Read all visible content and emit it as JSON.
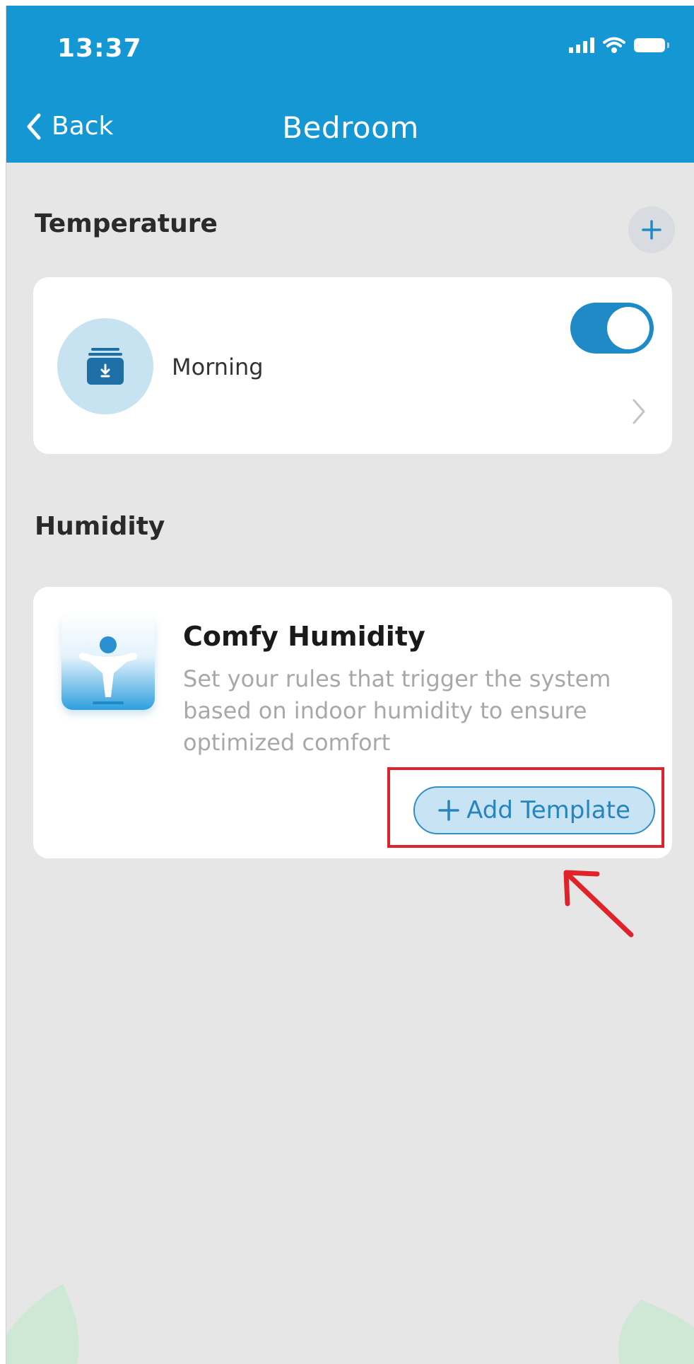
{
  "status_bar": {
    "time": "13:37"
  },
  "nav": {
    "back_label": "Back",
    "title": "Bedroom"
  },
  "temperature": {
    "heading": "Temperature",
    "schedule": {
      "name": "Morning",
      "enabled": true
    }
  },
  "humidity": {
    "heading": "Humidity",
    "template": {
      "title": "Comfy Humidity",
      "description": "Set your rules that trigger the system based on indoor humidity to ensure optimized comfort",
      "add_button_label": "Add Template"
    }
  },
  "colors": {
    "header": "#1597d3",
    "accent": "#1e8ac6",
    "highlight": "#e0232b",
    "background": "#e6e6e7"
  }
}
